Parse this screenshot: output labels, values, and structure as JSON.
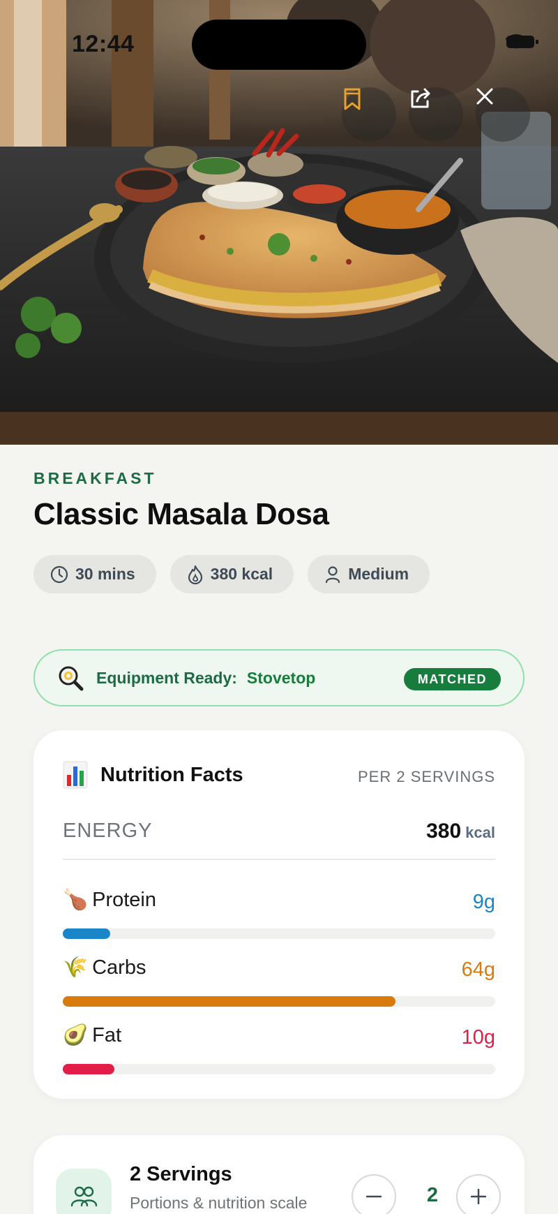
{
  "status_bar": {
    "time": "12:44"
  },
  "hero": {
    "bookmark_icon": "bookmark-icon",
    "share_icon": "share-icon",
    "close_icon": "close-icon",
    "accent_color": "#e8a22b"
  },
  "recipe": {
    "category": "BREAKFAST",
    "title": "Classic Masala Dosa",
    "chips": [
      {
        "icon": "clock-icon",
        "label": "30 mins"
      },
      {
        "icon": "flame-icon",
        "label": "380 kcal"
      },
      {
        "icon": "person-icon",
        "label": "Medium"
      }
    ]
  },
  "equipment": {
    "icon": "magnifier-pan-icon",
    "label": "Equipment Ready:",
    "value": "Stovetop",
    "badge": "MATCHED"
  },
  "nutrition": {
    "icon": "bar-chart-icon",
    "title": "Nutrition Facts",
    "per": "PER 2 SERVINGS",
    "energy_label": "ENERGY",
    "energy_value": "380",
    "energy_unit": "kcal",
    "macros": [
      {
        "name": "Protein",
        "value": "9g",
        "emoji": "🍗",
        "color": "#1a86c8",
        "fraction": 0.11
      },
      {
        "name": "Carbs",
        "value": "64g",
        "emoji": "🌾",
        "color": "#d97a0e",
        "fraction": 0.77
      },
      {
        "name": "Fat",
        "value": "10g",
        "emoji": "🥑",
        "color": "#e11d48",
        "fraction": 0.12
      }
    ]
  },
  "servings": {
    "icon": "people-icon",
    "title": "2 Servings",
    "subtitle": "Portions & nutrition scale",
    "count": "2",
    "minus_icon": "minus-icon",
    "plus_icon": "plus-icon"
  }
}
